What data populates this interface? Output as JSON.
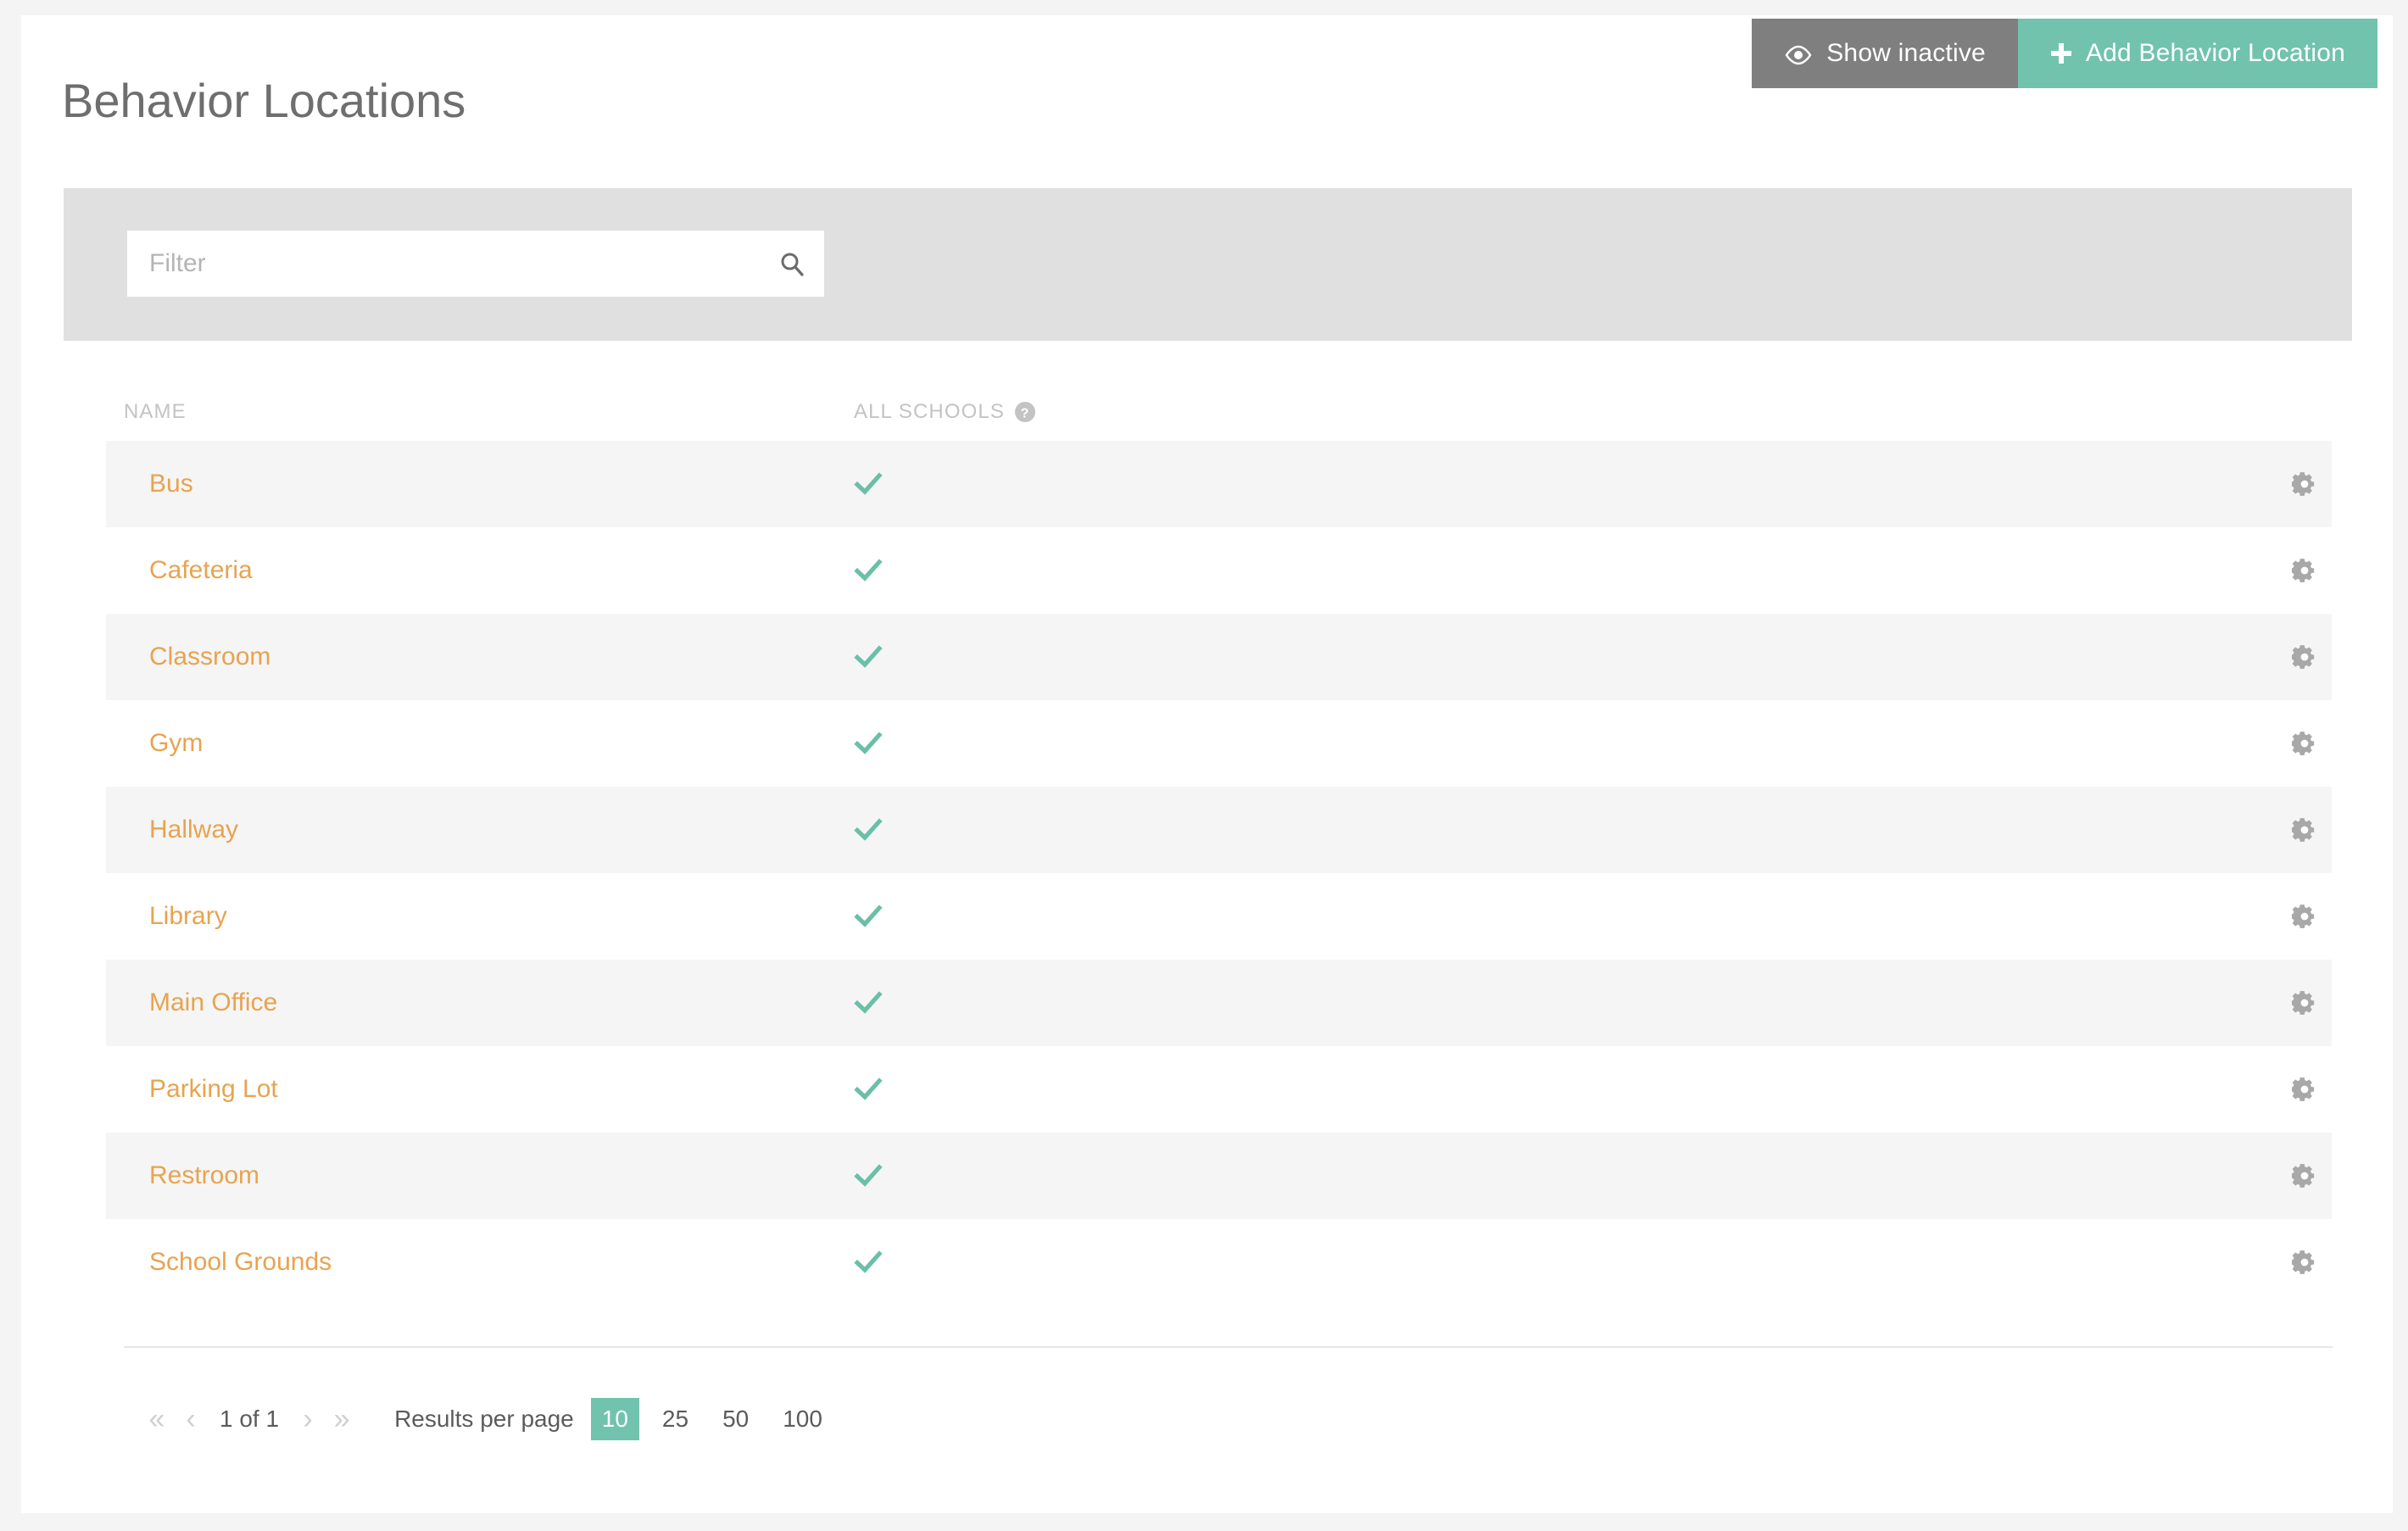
{
  "header": {
    "title": "Behavior Locations",
    "buttons": [
      {
        "label": "Show inactive",
        "icon": "eye-icon",
        "color": "#807f7f"
      },
      {
        "label": "Add Behavior Location",
        "icon": "plus-icon",
        "color": "#71c3ad"
      }
    ]
  },
  "filter": {
    "placeholder": "Filter",
    "value": "",
    "search_icon": "search-icon"
  },
  "table": {
    "columns": [
      {
        "key": "name",
        "label": "NAME"
      },
      {
        "key": "all_schools",
        "label": "ALL SCHOOLS",
        "help_icon": "help-circle-icon"
      }
    ],
    "rows": [
      {
        "name": "Bus",
        "all_schools": true,
        "action_icon": "gear-icon"
      },
      {
        "name": "Cafeteria",
        "all_schools": true,
        "action_icon": "gear-icon"
      },
      {
        "name": "Classroom",
        "all_schools": true,
        "action_icon": "gear-icon"
      },
      {
        "name": "Gym",
        "all_schools": true,
        "action_icon": "gear-icon"
      },
      {
        "name": "Hallway",
        "all_schools": true,
        "action_icon": "gear-icon"
      },
      {
        "name": "Library",
        "all_schools": true,
        "action_icon": "gear-icon"
      },
      {
        "name": "Main Office",
        "all_schools": true,
        "action_icon": "gear-icon"
      },
      {
        "name": "Parking Lot",
        "all_schools": true,
        "action_icon": "gear-icon"
      },
      {
        "name": "Restroom",
        "all_schools": true,
        "action_icon": "gear-icon"
      },
      {
        "name": "School Grounds",
        "all_schools": true,
        "action_icon": "gear-icon"
      }
    ]
  },
  "pagination": {
    "first_label": "«",
    "prev_label": "‹",
    "page_label": "1 of 1",
    "next_label": "›",
    "last_label": "»",
    "results_per_page_label": "Results per page",
    "options": [
      "10",
      "25",
      "50",
      "100"
    ],
    "selected": "10"
  },
  "colors": {
    "accent_teal": "#71c3ad",
    "link_orange": "#e8a34f",
    "gray_button": "#807f7f",
    "row_stripe": "#f5f5f5",
    "filter_bar": "#e0e0e0",
    "page_bg": "#f4f4f4"
  }
}
